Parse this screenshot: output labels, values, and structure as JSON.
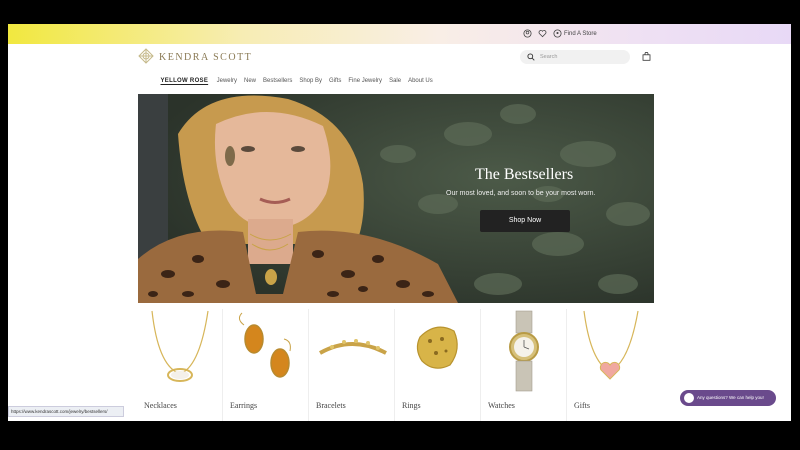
{
  "topbar": {
    "find_store": "Find A Store"
  },
  "header": {
    "logo_text": "KENDRA SCOTT",
    "search_placeholder": "Search"
  },
  "nav": [
    "YELLOW ROSE",
    "Jewelry",
    "New",
    "Bestsellers",
    "Shop By",
    "Gifts",
    "Fine Jewelry",
    "Sale",
    "About Us"
  ],
  "hero": {
    "title": "The Bestsellers",
    "subtitle": "Our most loved, and soon to be your most worn.",
    "button": "Shop Now"
  },
  "categories": [
    "Necklaces",
    "Earrings",
    "Bracelets",
    "Rings",
    "Watches",
    "Gifts"
  ],
  "status_url": "https://www.kendrascott.com/jewelry/bestsellers/",
  "chat": {
    "text": "Any questions? We can help you!"
  },
  "colors": {
    "brand_gold": "#8a7a55",
    "chat_purple": "#6a4a8c"
  }
}
